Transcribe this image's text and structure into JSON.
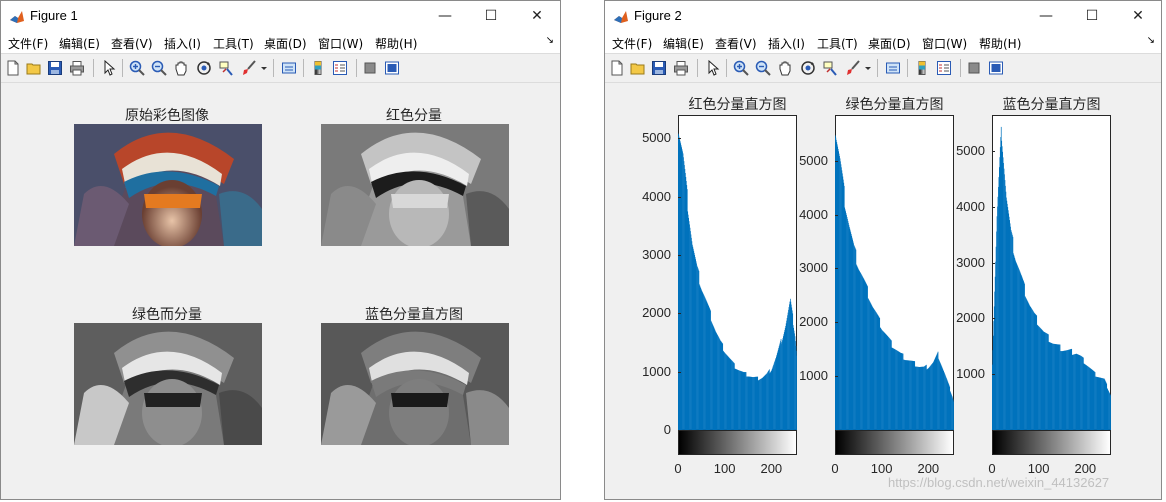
{
  "windows": [
    {
      "title": "Figure 1",
      "controls": {
        "minimize": "—",
        "maximize": "☐",
        "close": "✕"
      },
      "menu": [
        "文件(F)",
        "编辑(E)",
        "查看(V)",
        "插入(I)",
        "工具(T)",
        "桌面(D)",
        "窗口(W)",
        "帮助(H)"
      ],
      "subplots": [
        {
          "title": "原始彩色图像",
          "kind": "color-image"
        },
        {
          "title": "红色分量",
          "kind": "gray-image"
        },
        {
          "title": "绿色而分量",
          "kind": "gray-image"
        },
        {
          "title": "蓝色分量直方图",
          "kind": "gray-image"
        }
      ]
    },
    {
      "title": "Figure 2",
      "controls": {
        "minimize": "—",
        "maximize": "☐",
        "close": "✕"
      },
      "menu": [
        "文件(F)",
        "编辑(E)",
        "查看(V)",
        "插入(I)",
        "工具(T)",
        "桌面(D)",
        "窗口(W)",
        "帮助(H)"
      ]
    }
  ],
  "toolbar_icons": [
    "new-figure-icon",
    "open-file-icon",
    "save-icon",
    "print-icon",
    "pointer-icon",
    "zoom-in-icon",
    "zoom-out-icon",
    "pan-icon",
    "rotate-3d-icon",
    "data-cursor-icon",
    "brush-icon",
    "brush-dropdown-icon",
    "link-plot-icon",
    "colorbar-icon",
    "legend-icon",
    "hide-plot-tools-icon",
    "show-plot-tools-icon"
  ],
  "colors": {
    "bar": "#0072bd",
    "axes": "#262626",
    "window_bg": "#f0f0f0"
  },
  "chart_data": [
    {
      "type": "bar",
      "title": "红色分量直方图",
      "xlim": [
        0,
        255
      ],
      "ylim": [
        0,
        5400
      ],
      "xticks": [
        0,
        100,
        200
      ],
      "yticks": [
        0,
        1000,
        2000,
        3000,
        4000,
        5000
      ],
      "x": [
        0,
        10,
        20,
        30,
        40,
        50,
        60,
        70,
        80,
        90,
        100,
        110,
        120,
        130,
        140,
        150,
        160,
        170,
        180,
        190,
        200,
        210,
        220,
        230,
        240,
        250,
        255
      ],
      "values": [
        5200,
        4700,
        3900,
        3200,
        2750,
        2450,
        2200,
        1950,
        1700,
        1500,
        1350,
        1220,
        1100,
        1030,
        970,
        940,
        900,
        880,
        900,
        950,
        1050,
        1250,
        1500,
        1800,
        2200,
        1650,
        1200
      ]
    },
    {
      "type": "bar",
      "title": "绿色分量直方图",
      "xlim": [
        0,
        255
      ],
      "ylim": [
        0,
        5850
      ],
      "xticks": [
        0,
        100,
        200
      ],
      "yticks": [
        1000,
        2000,
        3000,
        4000,
        5000
      ],
      "x": [
        0,
        10,
        20,
        30,
        40,
        50,
        60,
        70,
        80,
        90,
        100,
        110,
        120,
        130,
        140,
        150,
        160,
        170,
        180,
        190,
        200,
        210,
        220,
        230,
        240,
        250,
        255
      ],
      "values": [
        5600,
        5000,
        4300,
        3800,
        3350,
        3050,
        2800,
        2550,
        2300,
        2100,
        1900,
        1750,
        1600,
        1500,
        1400,
        1330,
        1280,
        1230,
        1180,
        1150,
        1180,
        1250,
        1400,
        1150,
        900,
        650,
        500
      ]
    },
    {
      "type": "bar",
      "title": "蓝色分量直方图",
      "xlim": [
        0,
        255
      ],
      "ylim": [
        0,
        5650
      ],
      "xticks": [
        0,
        100,
        200
      ],
      "yticks": [
        1000,
        2000,
        3000,
        4000,
        5000
      ],
      "x": [
        0,
        10,
        20,
        30,
        40,
        50,
        60,
        70,
        80,
        90,
        100,
        110,
        120,
        130,
        140,
        150,
        160,
        170,
        180,
        190,
        200,
        210,
        220,
        230,
        240,
        250,
        255
      ],
      "values": [
        1200,
        3800,
        5400,
        4200,
        3500,
        3100,
        2800,
        2500,
        2250,
        2050,
        1900,
        1750,
        1650,
        1560,
        1500,
        1450,
        1420,
        1400,
        1380,
        1300,
        1200,
        1100,
        1000,
        950,
        900,
        700,
        600
      ]
    }
  ],
  "watermark": "https://blog.csdn.net/weixin_44132627"
}
